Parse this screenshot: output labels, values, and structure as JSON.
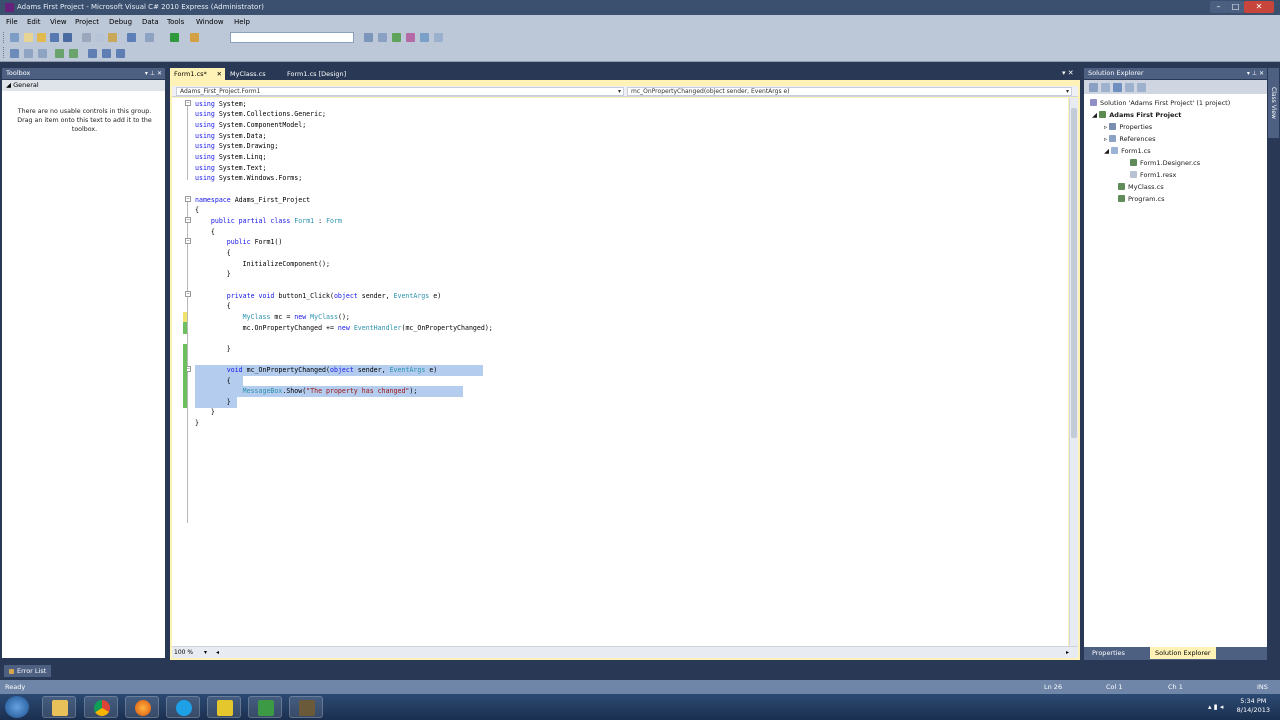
{
  "window": {
    "title": "Adams First Project - Microsoft Visual C# 2010 Express (Administrator)"
  },
  "menu": [
    "File",
    "Edit",
    "View",
    "Project",
    "Debug",
    "Data",
    "Tools",
    "Window",
    "Help"
  ],
  "toolbox": {
    "title": "Toolbox",
    "group": "General",
    "empty_message": "There are no usable controls in this group. Drag an item onto this text to add it to the toolbox."
  },
  "tabs": [
    {
      "label": "Form1.cs*",
      "active": true
    },
    {
      "label": "MyClass.cs",
      "active": false
    },
    {
      "label": "Form1.cs [Design]",
      "active": false
    }
  ],
  "navbar": {
    "type_dropdown": "Adams_First_Project.Form1",
    "member_dropdown": "mc_OnPropertyChanged(object sender, EventArgs e)"
  },
  "code_lines": [
    "using System;",
    "using System.Collections.Generic;",
    "using System.ComponentModel;",
    "using System.Data;",
    "using System.Drawing;",
    "using System.Linq;",
    "using System.Text;",
    "using System.Windows.Forms;",
    "",
    "namespace Adams_First_Project",
    "{",
    "    public partial class Form1 : Form",
    "    {",
    "        public Form1()",
    "        {",
    "            InitializeComponent();",
    "        }",
    "",
    "        private void button1_Click(object sender, EventArgs e)",
    "        {",
    "            MyClass mc = new MyClass();",
    "            mc.OnPropertyChanged += new EventHandler(mc_OnPropertyChanged);",
    "",
    "        }",
    "",
    "        void mc_OnPropertyChanged(object sender, EventArgs e)",
    "        {",
    "            MessageBox.Show(\"The property has changed\");",
    "        }",
    "    }",
    "}"
  ],
  "editor": {
    "zoom": "100 %"
  },
  "solution_explorer": {
    "title": "Solution Explorer",
    "solution": "Solution 'Adams First Project' (1 project)",
    "project": "Adams First Project",
    "items": [
      "Properties",
      "References",
      "Form1.cs",
      "Form1.Designer.cs",
      "Form1.resx",
      "MyClass.cs",
      "Program.cs"
    ],
    "bottom_tabs": [
      "Properties",
      "Solution Explorer"
    ]
  },
  "side_tab": "Class View",
  "error_list_tab": "Error List",
  "status": {
    "left": "Ready",
    "ln": "Ln 26",
    "col": "Col 1",
    "ch": "Ch 1",
    "mode": "INS"
  },
  "clock": {
    "time": "5:34 PM",
    "date": "8/14/2013"
  },
  "colors": {
    "keyword": "#1616e8",
    "type": "#2b91af",
    "string": "#a31515",
    "selection": "#b4cdee",
    "chrome": "#293955"
  }
}
